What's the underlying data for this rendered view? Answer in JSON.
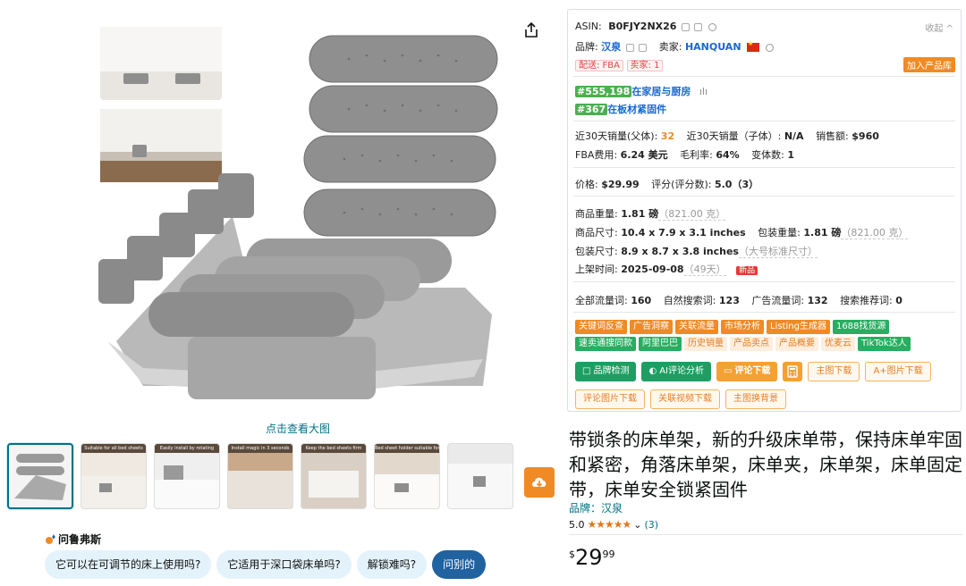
{
  "gallery": {
    "zoom_text": "点击查看大图",
    "thumb_captions": [
      "",
      "Suitable for all bed sheets",
      "Easily install by rotating",
      "Install magic in 3 seconds",
      "Keep the bed sheets firm",
      "Bed sheet holder suitable for all sheet sizes",
      ""
    ]
  },
  "ask": {
    "title": "问鲁弗斯",
    "chips": [
      "它可以在可调节的床上使用吗?",
      "它适用于深口袋床单吗?",
      "解锁难吗?",
      "问别的"
    ]
  },
  "panel": {
    "asin_label": "ASIN:",
    "asin": "B0FJY2NX26",
    "collect": "收起",
    "brand_label": "品牌:",
    "brand": "汉泉",
    "seller_label": "卖家:",
    "seller": "HANQUAN",
    "ship": "配送: FBA",
    "seller_count": "卖家: 1",
    "add_lib": "加入产品库",
    "rank1": "#555,198",
    "rank1_cat": "在家居与厨房",
    "rank2": "#367",
    "rank2_cat": "在板材紧固件",
    "sales30_parent_label": "近30天销量(父体):",
    "sales30_parent": "32",
    "sales30_child_label": "近30天销量（子体）:",
    "sales30_child": "N/A",
    "revenue_label": "销售额:",
    "revenue": "$960",
    "fba_label": "FBA费用:",
    "fba": "6.24 美元",
    "margin_label": "毛利率:",
    "margin": "64%",
    "variants_label": "变体数:",
    "variants": "1",
    "price_label": "价格:",
    "price": "$29.99",
    "rating_label": "评分(评分数):",
    "rating": "5.0（3）",
    "weight_label": "商品重量:",
    "weight": "1.81 磅",
    "weight_g": "（821.00 克）",
    "dims_label": "商品尺寸:",
    "dims": "10.4 x 7.9 x 3.1 inches",
    "pkg_weight_label": "包装重量:",
    "pkg_weight": "1.81 磅",
    "pkg_weight_g": "（821.00 克）",
    "pkg_dims_label": "包装尺寸:",
    "pkg_dims": "8.9 x 8.7 x 3.8 inches",
    "pkg_dims_note": "（大号标准尺寸）",
    "listed_label": "上架时间:",
    "listed": "2025-09-08",
    "listed_days": "（49天）",
    "new_badge": "新品",
    "kw_all_label": "全部流量词:",
    "kw_all": "160",
    "kw_natural_label": "自然搜索词:",
    "kw_natural": "123",
    "kw_ads_label": "广告流量词:",
    "kw_ads": "132",
    "kw_rec_label": "搜索推荐词:",
    "kw_rec": "0",
    "tools1": [
      "关键词反查",
      "广告洞察",
      "关联流量",
      "市场分析",
      "Listing生成器",
      "1688找货源"
    ],
    "tools2": [
      "速卖通搜同款",
      "阿里巴巴",
      "历史销量",
      "产品卖点",
      "产品概要",
      "优麦云",
      "TikTok达人"
    ],
    "buttons1": [
      "品牌检测",
      "AI评论分析",
      "评论下载",
      "主图下载",
      "A+图片下载"
    ],
    "buttons2": [
      "评论图片下载",
      "关联视频下载",
      "主图换背景"
    ]
  },
  "product": {
    "title": "带锁条的床单架，新的升级床单带，保持床单牢固和紧密，角落床单架，床单夹，床单架，床单固定带，床单安全锁紧固件",
    "brand_link": "品牌：汉泉",
    "rating": "5.0",
    "stars": "★★★★★",
    "review_count": "(3)",
    "price_symbol": "$",
    "price_whole": "29",
    "price_fraction": "99"
  },
  "colors": {
    "accent_orange": "#f08a24",
    "link_blue": "#007185",
    "green": "#1e9e62"
  }
}
